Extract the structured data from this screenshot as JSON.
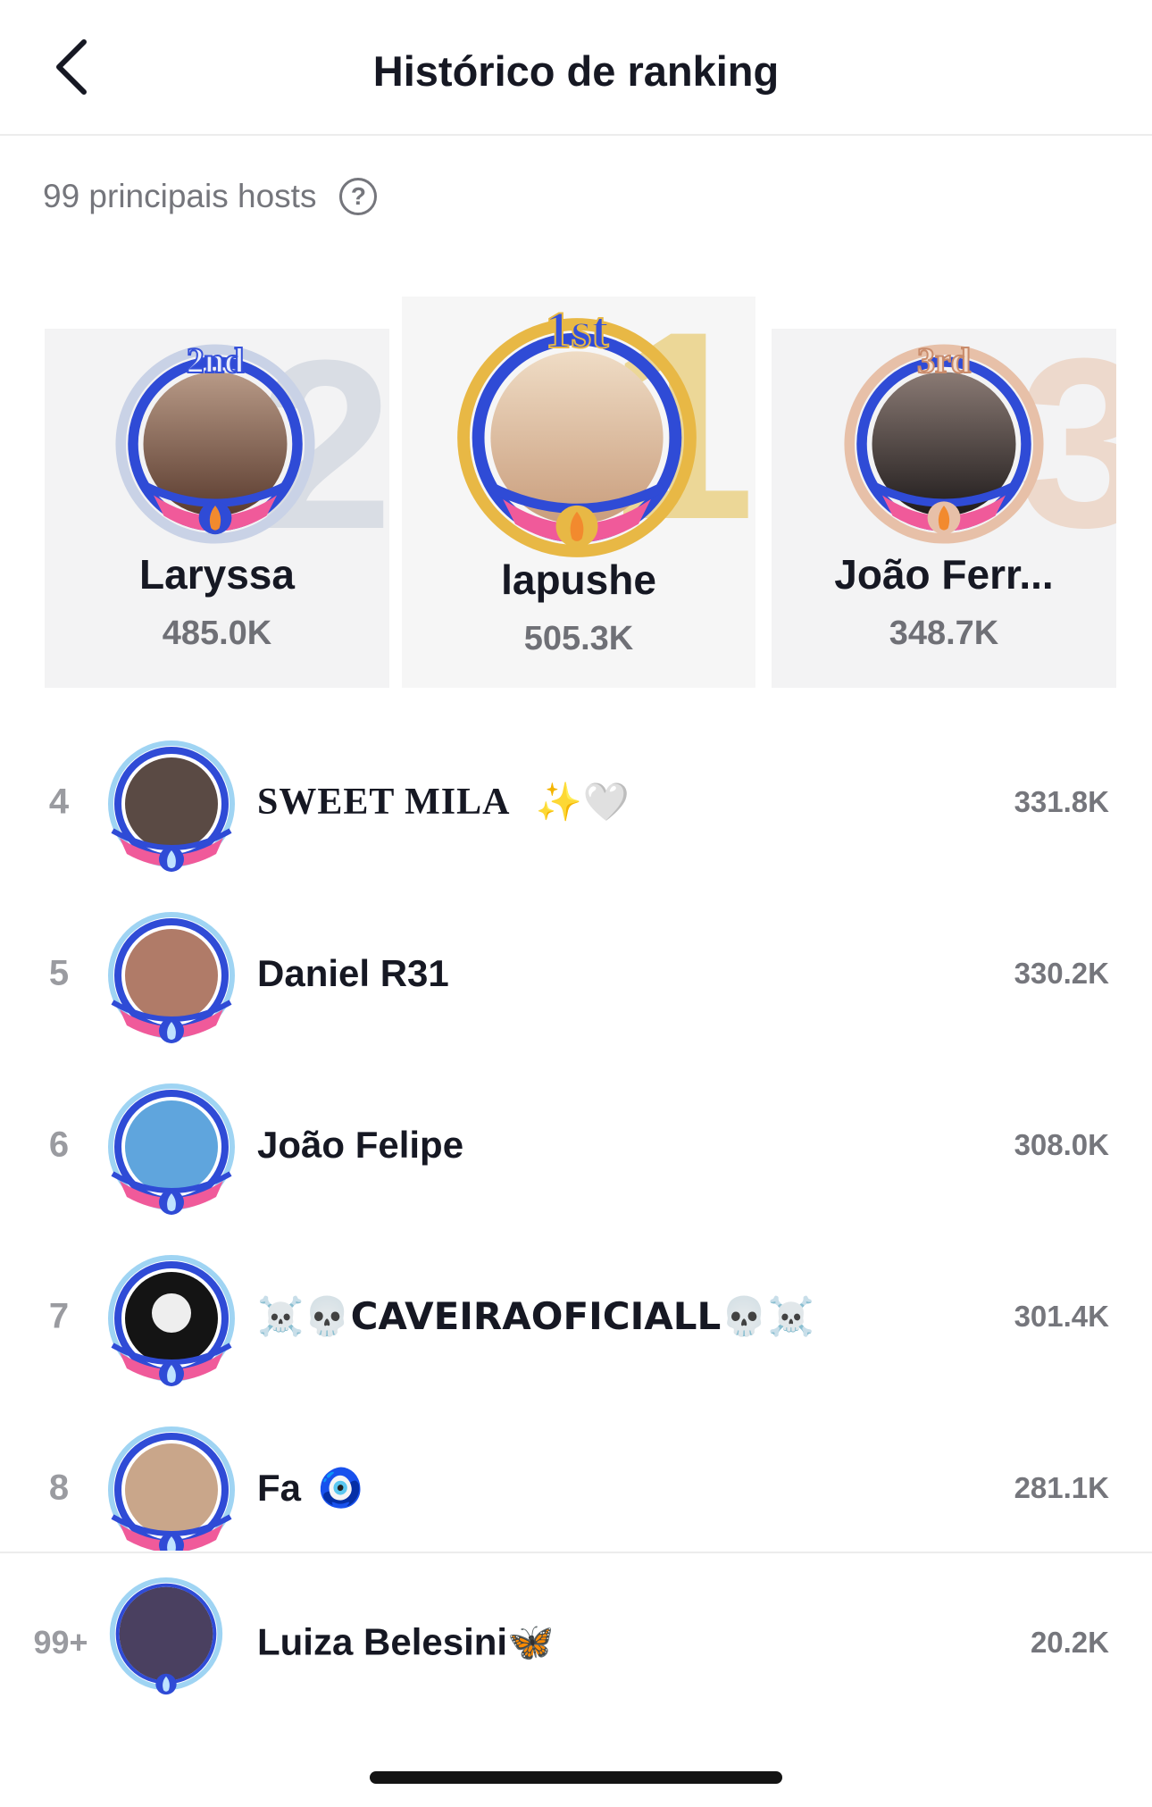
{
  "header": {
    "title": "Histórico de ranking"
  },
  "subheader": {
    "label": "99 principais hosts",
    "help": "?"
  },
  "podium": [
    {
      "position": "2",
      "ribbon": "2nd",
      "name": "Laryssa",
      "score": "485.0K"
    },
    {
      "position": "1",
      "ribbon": "1st",
      "name": "lapushe",
      "score": "505.3K"
    },
    {
      "position": "3",
      "ribbon": "3rd",
      "name": "João Ferr...",
      "score": "348.7K"
    }
  ],
  "list": [
    {
      "rank": "4",
      "name": "SWEET  MILA",
      "emoji": "✨🤍",
      "score": "331.8K"
    },
    {
      "rank": "5",
      "name": "Daniel R31",
      "emoji": "",
      "score": "330.2K"
    },
    {
      "rank": "6",
      "name": "João Felipe",
      "emoji": "",
      "score": "308.0K"
    },
    {
      "rank": "7",
      "name": "☠️💀CAVEIRAOFICIALL💀☠️",
      "emoji": "",
      "score": "301.4K"
    },
    {
      "rank": "8",
      "name": "Fa",
      "emoji": "🧿",
      "score": "281.1K"
    }
  ],
  "me": {
    "rank": "99+",
    "name": "Luiza Belesini🦋",
    "score": "20.2K"
  },
  "colors": {
    "ring_blue": "#2f4bd6",
    "ring_pink": "#f05a9a",
    "flame": "#f28a2e",
    "gold": "#e8b845"
  }
}
